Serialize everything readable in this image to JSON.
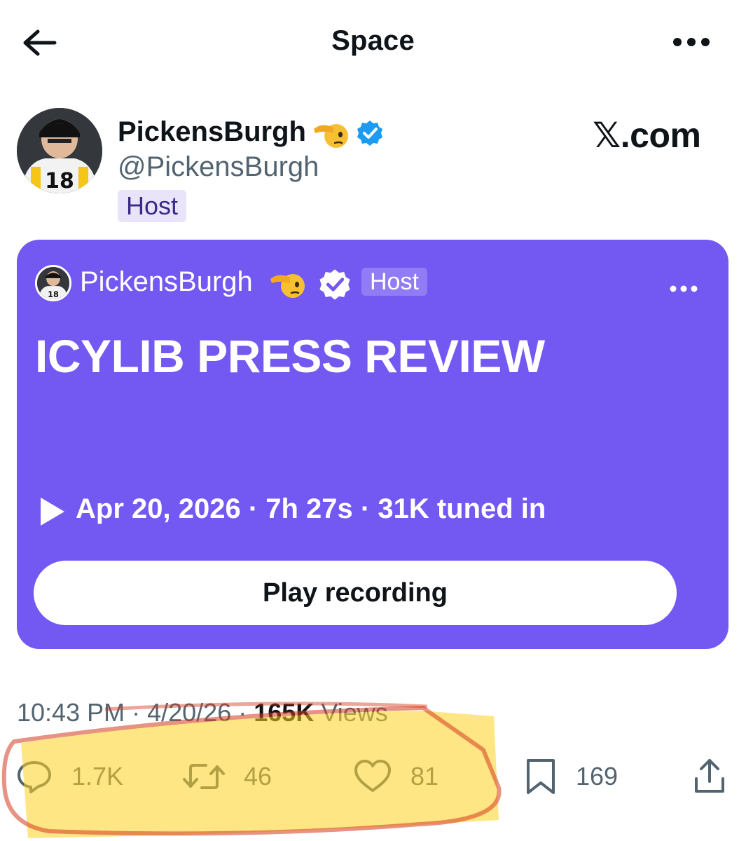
{
  "header": {
    "title": "Space"
  },
  "author": {
    "name": "PickensBurgh",
    "handle": "@PickensBurgh",
    "role_badge": "Host",
    "emoji": "🫡",
    "verified": true
  },
  "brand": "𝕏.com",
  "space_card": {
    "host_name": "PickensBurgh",
    "host_badge": "Host",
    "title": "ICYLIB PRESS REVIEW",
    "meta": "Apr 20, 2026 · 7h 27s · 31K tuned in",
    "play_button_label": "Play recording",
    "background_color": "#7458f2"
  },
  "post_meta": {
    "time": "10:43 PM",
    "date": "4/20/26",
    "views_count": "165K",
    "views_label": "Views"
  },
  "actions": {
    "replies": "1.7K",
    "reposts": "46",
    "likes": "81",
    "bookmarks": "169"
  },
  "colors": {
    "accent": "#7458f2",
    "verified": "#1d9bf0",
    "highlight": "#ffd21f",
    "scribble": "#d33a1f"
  }
}
